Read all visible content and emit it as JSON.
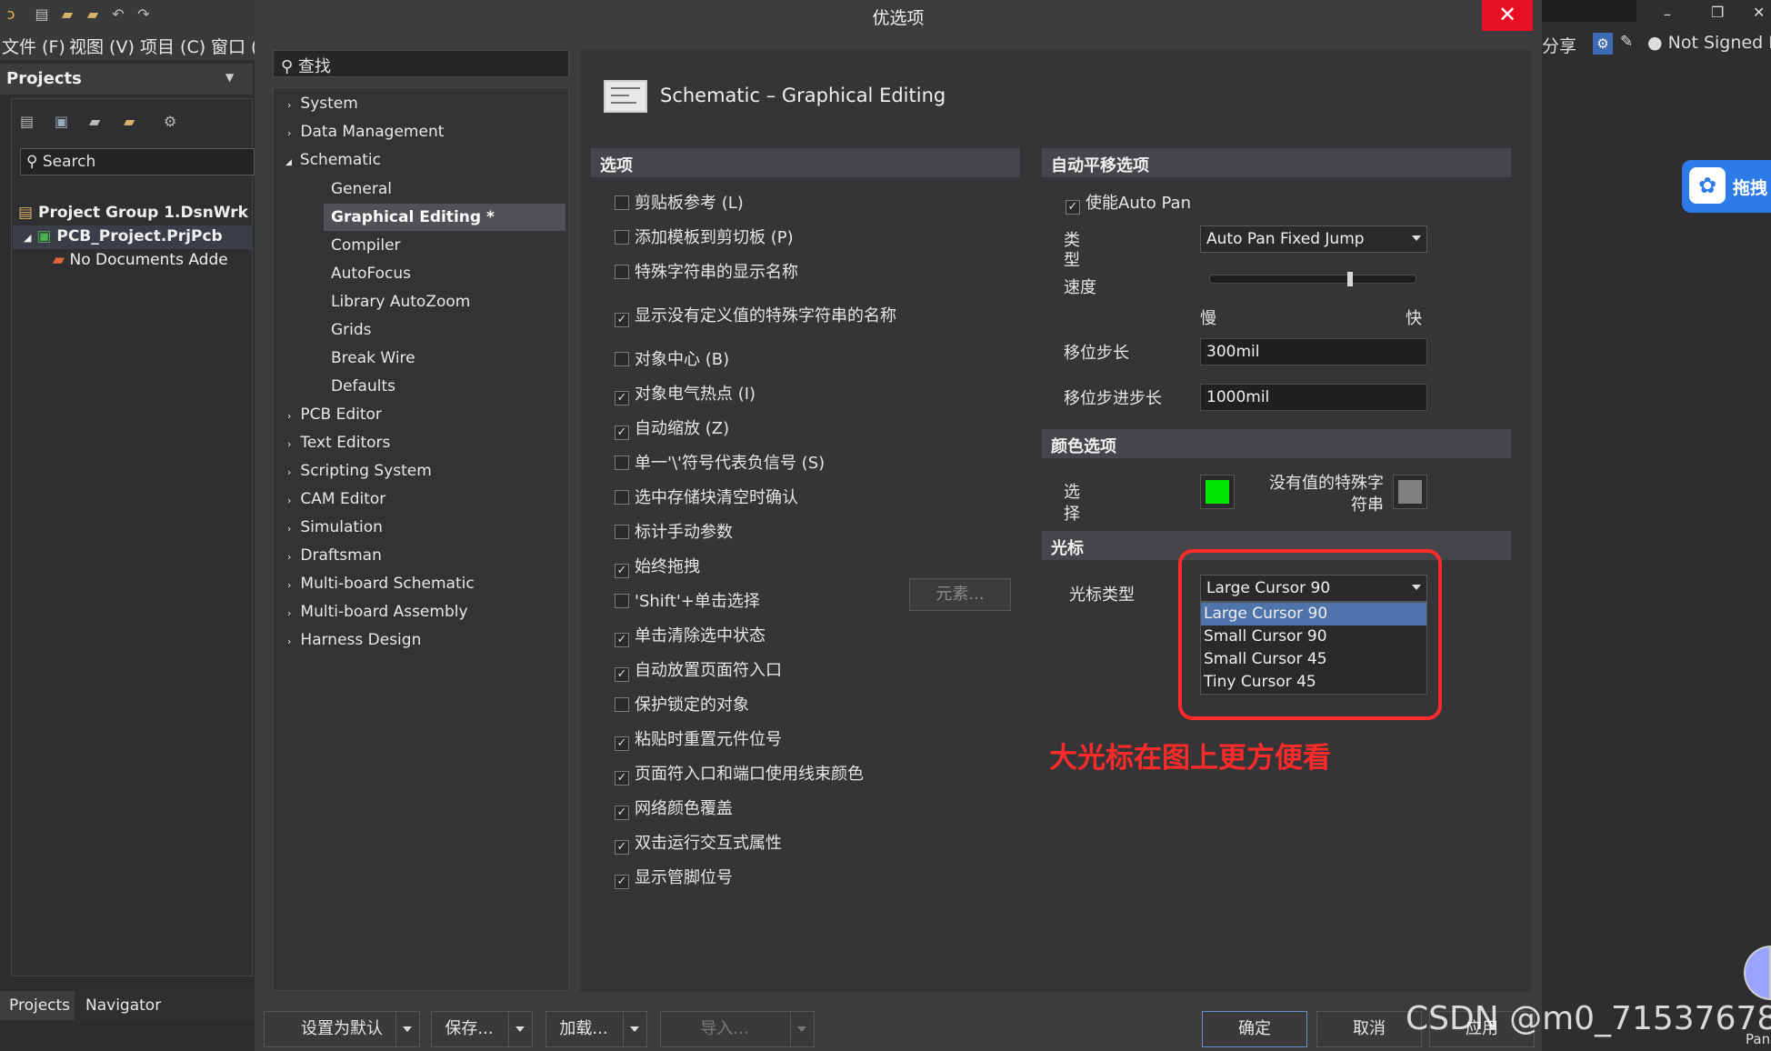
{
  "topbar": {
    "menu": [
      "文件 (F)",
      "视图 (V)",
      "项目 (C)",
      "窗口 ("
    ]
  },
  "projects": {
    "title": "Projects",
    "search_placeholder": "Search",
    "tree": [
      "Project Group 1.DsnWrk",
      "PCB_Project.PrjPcb",
      "No Documents Adde"
    ],
    "tabs": [
      "Projects",
      "Navigator"
    ]
  },
  "dialog": {
    "title": "优选项",
    "close": "✕",
    "search_placeholder": "查找",
    "nav": {
      "top": [
        "System",
        "Data Management",
        "Schematic"
      ],
      "schematic_children": [
        "General",
        "Graphical Editing *",
        "Compiler",
        "AutoFocus",
        "Library AutoZoom",
        "Grids",
        "Break Wire",
        "Defaults"
      ],
      "rest": [
        "PCB Editor",
        "Text Editors",
        "Scripting System",
        "CAM Editor",
        "Simulation",
        "Draftsman",
        "Multi-board Schematic",
        "Multi-board Assembly",
        "Harness Design"
      ]
    },
    "page_title": "Schematic – Graphical Editing",
    "options": {
      "header": "选项",
      "items": [
        {
          "label": "剪贴板参考 (L)",
          "checked": false
        },
        {
          "label": "添加模板到剪切板 (P)",
          "checked": false
        },
        {
          "label": "特殊字符串的显示名称",
          "checked": false
        },
        {
          "label": "显示没有定义值的特殊字符串的名称",
          "checked": true
        },
        {
          "label": "对象中心 (B)",
          "checked": false
        },
        {
          "label": "对象电气热点 (I)",
          "checked": true
        },
        {
          "label": "自动缩放 (Z)",
          "checked": true
        },
        {
          "label": "单一'\\'符号代表负信号 (S)",
          "checked": false
        },
        {
          "label": "选中存储块清空时确认",
          "checked": false
        },
        {
          "label": "标计手动参数",
          "checked": false
        },
        {
          "label": "始终拖拽",
          "checked": true
        },
        {
          "label": "'Shift'+单击选择",
          "checked": false
        },
        {
          "label": "单击清除选中状态",
          "checked": true
        },
        {
          "label": "自动放置页面符入口",
          "checked": true
        },
        {
          "label": "保护锁定的对象",
          "checked": false
        },
        {
          "label": "粘贴时重置元件位号",
          "checked": true
        },
        {
          "label": "页面符入口和端口使用线束颜色",
          "checked": true
        },
        {
          "label": "网络颜色覆盖",
          "checked": true
        },
        {
          "label": "双击运行交互式属性",
          "checked": true
        },
        {
          "label": "显示管脚位号",
          "checked": true
        }
      ],
      "elements_button": "元素..."
    },
    "autopan": {
      "header": "自动平移选项",
      "enable_label": "使能Auto Pan",
      "type_label": "类型",
      "type_value": "Auto Pan Fixed Jump",
      "speed_label": "速度",
      "speed_level": 0.68,
      "slow": "慢",
      "fast": "快",
      "step_label": "移位步长",
      "step_value": "300mil",
      "shift_step_label": "移位步进步长",
      "shift_step_value": "1000mil"
    },
    "colors": {
      "header": "颜色选项",
      "select_label": "选择",
      "select_color": "#00e600",
      "nochar_label": "没有值的特殊字符串",
      "nochar_color": "#808080"
    },
    "cursor": {
      "header": "光标",
      "type_label": "光标类型",
      "value": "Large Cursor 90",
      "options": [
        "Large Cursor 90",
        "Small Cursor 90",
        "Small Cursor 45",
        "Tiny Cursor 45"
      ],
      "annotation": "大光标在图上更方便看",
      "annotation_color": "#ff2a2a"
    },
    "footer": {
      "set_default": "设置为默认",
      "save": "保存...",
      "load": "加载...",
      "import": "导入...",
      "ok": "确定",
      "cancel": "取消",
      "apply": "应用"
    }
  },
  "right": {
    "share": "分享",
    "signed": "Not Signed I",
    "cloud_label": "拖拽",
    "pan_label": "Pan"
  },
  "watermark": "CSDN @m0_71537678"
}
